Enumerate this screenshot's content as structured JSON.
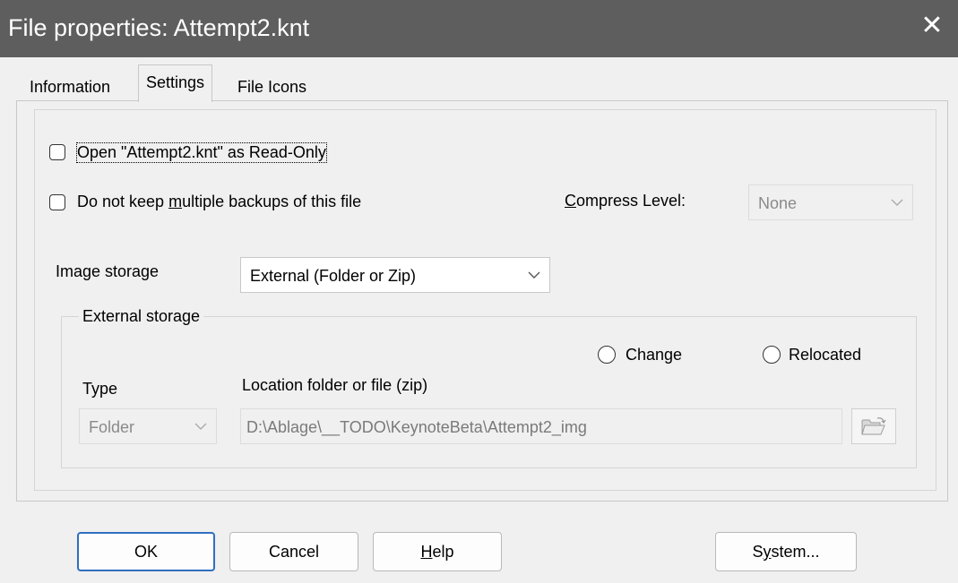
{
  "window": {
    "title": "File properties: Attempt2.knt",
    "close_glyph": "✕"
  },
  "tabs": [
    {
      "label": "Information",
      "active": false
    },
    {
      "label": "Settings",
      "active": true
    },
    {
      "label": "File Icons",
      "active": false
    }
  ],
  "settings": {
    "read_only": {
      "label": "Open \"Attempt2.knt\" as Read-Only",
      "checked": false
    },
    "no_backups": {
      "label_pre": "Do not keep ",
      "label_accel": "m",
      "label_post": "ultiple backups of this file",
      "checked": false
    },
    "compress": {
      "label_accel": "C",
      "label_post": "ompress Level:",
      "value": "None",
      "enabled": false
    },
    "image_storage": {
      "label": "Image storage",
      "value": "External (Folder or Zip)"
    },
    "external_storage": {
      "group_label": "External storage",
      "radio_change": {
        "label": "Change",
        "selected": false
      },
      "radio_relocated": {
        "label": "Relocated",
        "selected": false
      },
      "type_label": "Type",
      "type_value": "Folder",
      "location_label": "Location folder or file (zip)",
      "location_value": "D:\\Ablage\\__TODO\\KeynoteBeta\\Attempt2_img",
      "browse_icon": "folder-open-icon"
    }
  },
  "buttons": {
    "ok": "OK",
    "cancel": "Cancel",
    "help_accel": "H",
    "help_post": "elp",
    "system_pre": "S",
    "system_accel": "y",
    "system_post": "stem..."
  },
  "colors": {
    "titlebar": "#5e5e5e",
    "default_button_border": "#2f6fbf",
    "background": "#f0f0f0"
  }
}
